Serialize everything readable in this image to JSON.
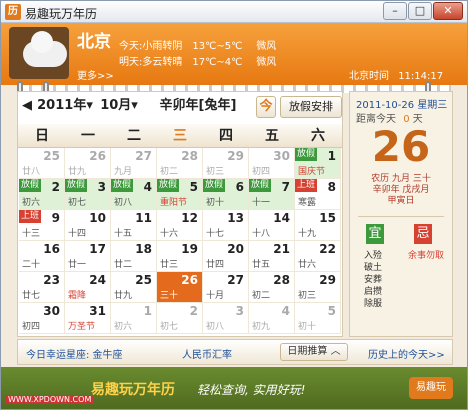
{
  "window": {
    "title": "易趣玩万年历",
    "min": "–",
    "restore": "□",
    "close": "✕",
    "app_icon": "历"
  },
  "weather": {
    "city": "北京",
    "more": "更多>>",
    "today_label": "今天:",
    "today_desc": "小雨转阴",
    "today_temp": "13℃~5℃",
    "today_wind": "微风",
    "tomorrow_label": "明天:",
    "tomorrow_desc": "多云转晴",
    "tomorrow_temp": "17℃~4℃",
    "tomorrow_wind": "微风",
    "time_label": "北京时间",
    "time": "11:14:17",
    "icon": "cloud-icon"
  },
  "nav": {
    "year": "2011年",
    "month": "10月",
    "ganzhi": "辛卯年[兔年]",
    "today_btn": "今",
    "holiday_btn": "放假安排"
  },
  "weekdays": [
    "日",
    "一",
    "二",
    "三",
    "四",
    "五",
    "六"
  ],
  "weeks": [
    [
      {
        "d": "25",
        "l": "廿八",
        "g": 1
      },
      {
        "d": "26",
        "l": "廿九",
        "g": 1
      },
      {
        "d": "27",
        "l": "九月",
        "g": 1
      },
      {
        "d": "28",
        "l": "初二",
        "g": 1
      },
      {
        "d": "29",
        "l": "初三",
        "g": 1
      },
      {
        "d": "30",
        "l": "初四",
        "g": 1
      },
      {
        "d": "1",
        "l": "国庆节",
        "t": "放假",
        "tr": 1,
        "gr": 1
      }
    ],
    [
      {
        "d": "2",
        "l": "初六",
        "t": "放假",
        "gr": 1
      },
      {
        "d": "3",
        "l": "初七",
        "t": "放假",
        "gr": 1
      },
      {
        "d": "4",
        "l": "初八",
        "t": "放假",
        "gr": 1
      },
      {
        "d": "5",
        "l": "重阳节",
        "t": "放假",
        "gr": 1,
        "lr": 1
      },
      {
        "d": "6",
        "l": "初十",
        "t": "放假",
        "gr": 1
      },
      {
        "d": "7",
        "l": "十一",
        "t": "放假",
        "gr": 1
      },
      {
        "d": "8",
        "l": "寒露",
        "t": "上班",
        "tr": 2
      }
    ],
    [
      {
        "d": "9",
        "l": "十三",
        "t": "上班",
        "tr": 2
      },
      {
        "d": "10",
        "l": "十四"
      },
      {
        "d": "11",
        "l": "十五"
      },
      {
        "d": "12",
        "l": "十六"
      },
      {
        "d": "13",
        "l": "十七"
      },
      {
        "d": "14",
        "l": "十八"
      },
      {
        "d": "15",
        "l": "十九"
      }
    ],
    [
      {
        "d": "16",
        "l": "二十"
      },
      {
        "d": "17",
        "l": "廿一"
      },
      {
        "d": "18",
        "l": "廿二"
      },
      {
        "d": "19",
        "l": "廿三"
      },
      {
        "d": "20",
        "l": "廿四"
      },
      {
        "d": "21",
        "l": "廿五"
      },
      {
        "d": "22",
        "l": "廿六"
      }
    ],
    [
      {
        "d": "23",
        "l": "廿七"
      },
      {
        "d": "24",
        "l": "霜降",
        "lr": 1
      },
      {
        "d": "25",
        "l": "廿九"
      },
      {
        "d": "26",
        "l": "三十",
        "today": 1
      },
      {
        "d": "27",
        "l": "十月"
      },
      {
        "d": "28",
        "l": "初二"
      },
      {
        "d": "29",
        "l": "初三"
      }
    ],
    [
      {
        "d": "30",
        "l": "初四"
      },
      {
        "d": "31",
        "l": "万圣节",
        "lr": 1
      },
      {
        "d": "1",
        "l": "初六",
        "g": 1
      },
      {
        "d": "2",
        "l": "初七",
        "g": 1
      },
      {
        "d": "3",
        "l": "初八",
        "g": 1
      },
      {
        "d": "4",
        "l": "初九",
        "g": 1
      },
      {
        "d": "5",
        "l": "初十",
        "g": 1
      }
    ]
  ],
  "side": {
    "date": "2011-10-26",
    "weekday": "星期三",
    "from_today": "距离今天",
    "days": "0",
    "days_unit": "天",
    "big": "26",
    "lunar1": "农历 九月 三十",
    "lunar2": "辛卯年 戊戌月",
    "lunar3": "甲寅日",
    "yi": "宜",
    "ji": "忌",
    "yi_items": [
      "入殓",
      "破土",
      "安葬",
      "启攒",
      "除服"
    ],
    "ji_items": [
      "余事勿取"
    ]
  },
  "bottom": {
    "lucky": "今日幸运星座: 金牛座",
    "rate": "人民币汇率",
    "calc": "日期推算",
    "history": "历史上的今天>>"
  },
  "footer": {
    "brand": "易趣玩万年历",
    "slogan": "轻松查询, 实用好玩!",
    "badge": "易趣玩",
    "site": "WWW.XPDOWN.COM"
  }
}
